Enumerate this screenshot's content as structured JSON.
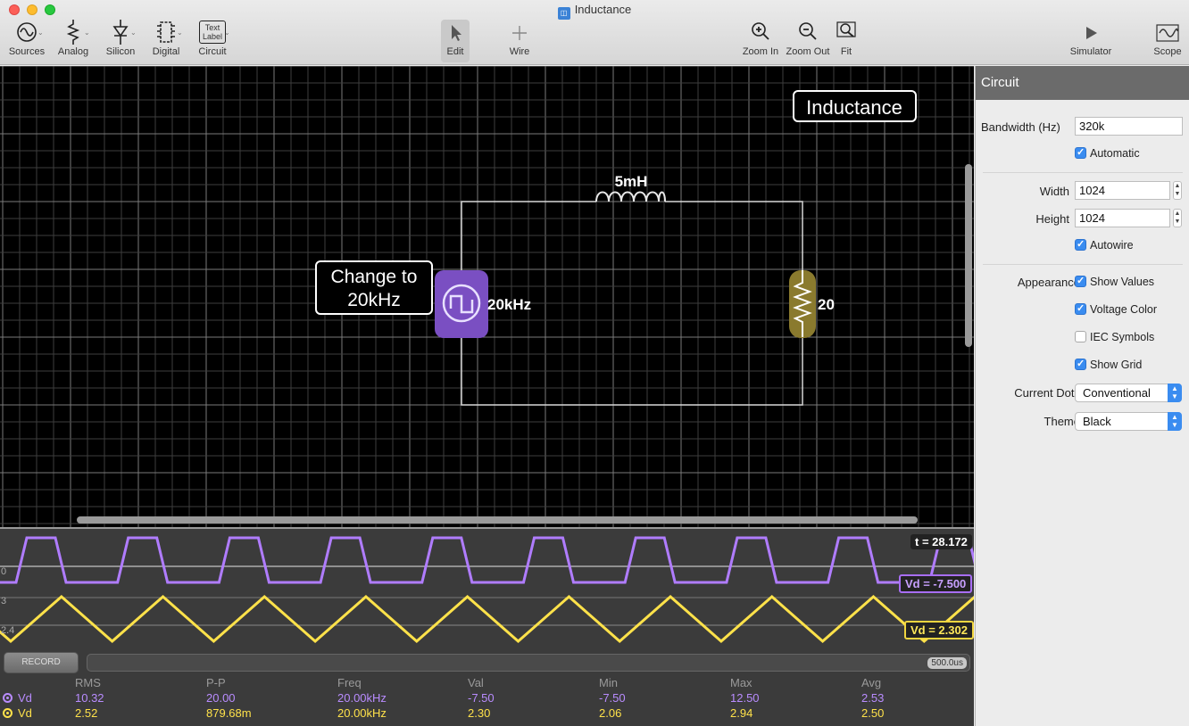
{
  "window": {
    "title": "Inductance"
  },
  "toolbar": {
    "sources": "Sources",
    "analog": "Analog",
    "silicon": "Silicon",
    "digital": "Digital",
    "circuit": "Circuit",
    "text_label_icon": "Text\nLabel",
    "edit": "Edit",
    "wire": "Wire",
    "zoom_in": "Zoom In",
    "zoom_out": "Zoom Out",
    "fit": "Fit",
    "simulator": "Simulator",
    "scope": "Scope"
  },
  "canvas": {
    "title_label": "Inductance",
    "note_label": "Change to\n20kHz",
    "inductor_value": "5mH",
    "source_value": "20kHz",
    "resistor_value": "20",
    "source_color": "#7a4fc2",
    "resistor_color": "#8a7a2e"
  },
  "scope": {
    "time_badge": "t = 28.172",
    "trace1_badge": "Vd = -7.500",
    "trace2_badge": "Vd = 2.302",
    "axis_zero": "0",
    "axis_three": "3",
    "axis_twofour": "2.4",
    "record": "RECORD",
    "timescale": "500.0us",
    "trace1_color": "#b07cff",
    "trace2_color": "#ffe24a",
    "headers": [
      "RMS",
      "P-P",
      "Freq",
      "Val",
      "Min",
      "Max",
      "Avg"
    ],
    "rows": [
      {
        "name": "Vd",
        "values": [
          "10.32",
          "20.00",
          "20.00kHz",
          "-7.50",
          "-7.50",
          "12.50",
          "2.53"
        ]
      },
      {
        "name": "Vd",
        "values": [
          "2.52",
          "879.68m",
          "20.00kHz",
          "2.30",
          "2.06",
          "2.94",
          "2.50"
        ]
      }
    ]
  },
  "inspector": {
    "header": "Circuit",
    "bandwidth_label": "Bandwidth (Hz)",
    "bandwidth_value": "320k",
    "automatic": "Automatic",
    "width_label": "Width",
    "width_value": "1024",
    "height_label": "Height",
    "height_value": "1024",
    "autowire": "Autowire",
    "appearance_label": "Appearance",
    "show_values": "Show Values",
    "voltage_color": "Voltage Color",
    "iec_symbols": "IEC Symbols",
    "show_grid": "Show Grid",
    "current_dots_label": "Current Dots",
    "current_dots_value": "Conventional",
    "theme_label": "Theme",
    "theme_value": "Black"
  }
}
